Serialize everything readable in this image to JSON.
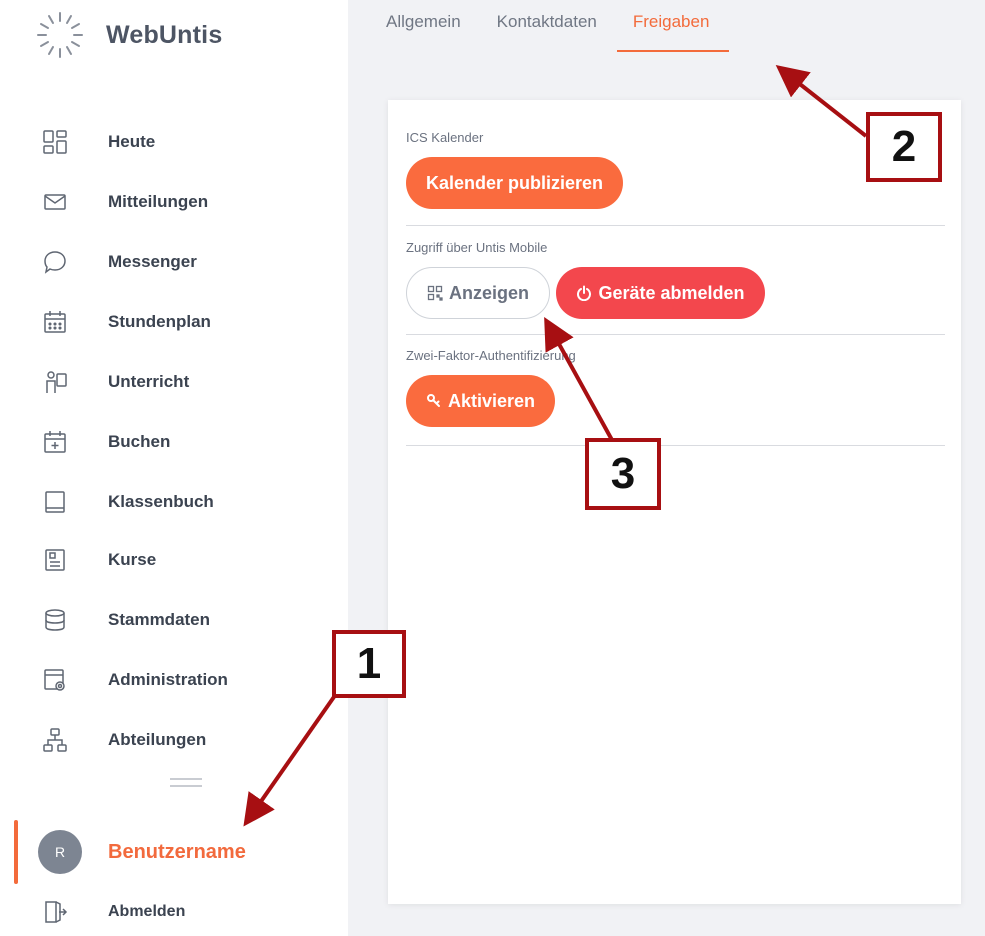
{
  "app": {
    "title": "WebUntis"
  },
  "sidebar": {
    "items": [
      {
        "label": "Heute",
        "icon": "dashboard-icon"
      },
      {
        "label": "Mitteilungen",
        "icon": "envelope-icon"
      },
      {
        "label": "Messenger",
        "icon": "chat-bubble-icon"
      },
      {
        "label": "Stundenplan",
        "icon": "calendar-icon"
      },
      {
        "label": "Unterricht",
        "icon": "teacher-board-icon"
      },
      {
        "label": "Buchen",
        "icon": "calendar-add-icon"
      },
      {
        "label": "Klassenbuch",
        "icon": "book-icon"
      },
      {
        "label": "Kurse",
        "icon": "course-list-icon"
      },
      {
        "label": "Stammdaten",
        "icon": "database-icon"
      },
      {
        "label": "Administration",
        "icon": "admin-settings-icon"
      },
      {
        "label": "Abteilungen",
        "icon": "org-chart-icon"
      }
    ],
    "user": {
      "initial": "R",
      "name": "Benutzername"
    },
    "logout_label": "Abmelden"
  },
  "tabs": [
    {
      "label": "Allgemein",
      "active": false
    },
    {
      "label": "Kontaktdaten",
      "active": false
    },
    {
      "label": "Freigaben",
      "active": true
    }
  ],
  "content": {
    "ics": {
      "title": "ICS Kalender",
      "button": "Kalender publizieren"
    },
    "mobile": {
      "title": "Zugriff über Untis Mobile",
      "show_button": "Anzeigen",
      "logout_devices_button": "Geräte abmelden"
    },
    "twofa": {
      "title": "Zwei-Faktor-Authentifizierung",
      "activate_button": "Aktivieren"
    }
  },
  "annotations": [
    "1",
    "2",
    "3"
  ],
  "colors": {
    "accent": "#f36b3b",
    "danger": "#f3474d",
    "annotation": "#a70f12"
  }
}
